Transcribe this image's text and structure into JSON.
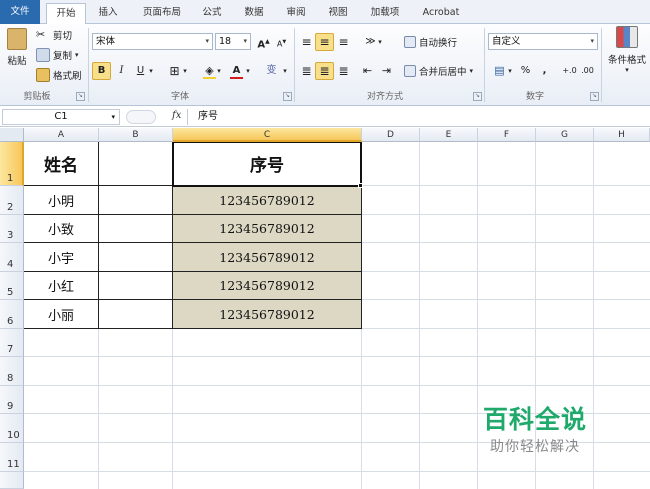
{
  "tabs": [
    "文件",
    "开始",
    "插入",
    "页面布局",
    "公式",
    "数据",
    "审阅",
    "视图",
    "加载项",
    "Acrobat"
  ],
  "active_tab": "开始",
  "clipboard": {
    "paste": "粘贴",
    "cut": "剪切",
    "copy": "复制",
    "format_painter": "格式刷",
    "label": "剪贴板"
  },
  "font": {
    "name": "宋体",
    "size": "18",
    "bold": "B",
    "italic": "I",
    "underline": "U",
    "grow": "A",
    "shrink": "A",
    "label": "字体",
    "phonetic": "变"
  },
  "alignment": {
    "wrap": "自动换行",
    "merge": "合并后居中",
    "label": "对齐方式"
  },
  "number": {
    "format": "自定义",
    "percent": "%",
    "comma": ",",
    "label": "数字"
  },
  "styles": {
    "conditional": "条件格式"
  },
  "formula_bar": {
    "name_box": "C1",
    "fx": "fx",
    "content": "序号"
  },
  "columns": [
    "A",
    "B",
    "C",
    "D",
    "E",
    "F",
    "G",
    "H"
  ],
  "rows": [
    "1",
    "2",
    "3",
    "4",
    "5",
    "6",
    "7",
    "8",
    "9",
    "10",
    "11"
  ],
  "table": {
    "header": {
      "a": "姓名",
      "c": "序号"
    },
    "names": [
      "小明",
      "小致",
      "小宇",
      "小红",
      "小丽"
    ],
    "ids": [
      "123456789012",
      "123456789012",
      "123456789012",
      "123456789012",
      "123456789012"
    ]
  },
  "watermark": {
    "title": "百科全说",
    "subtitle": "助你轻松解决"
  },
  "colors": {
    "file_tab": "#2a6aaf",
    "selection": "#f6c75a",
    "number_fill": "#ddd8c4",
    "watermark": "#1fa96b"
  }
}
